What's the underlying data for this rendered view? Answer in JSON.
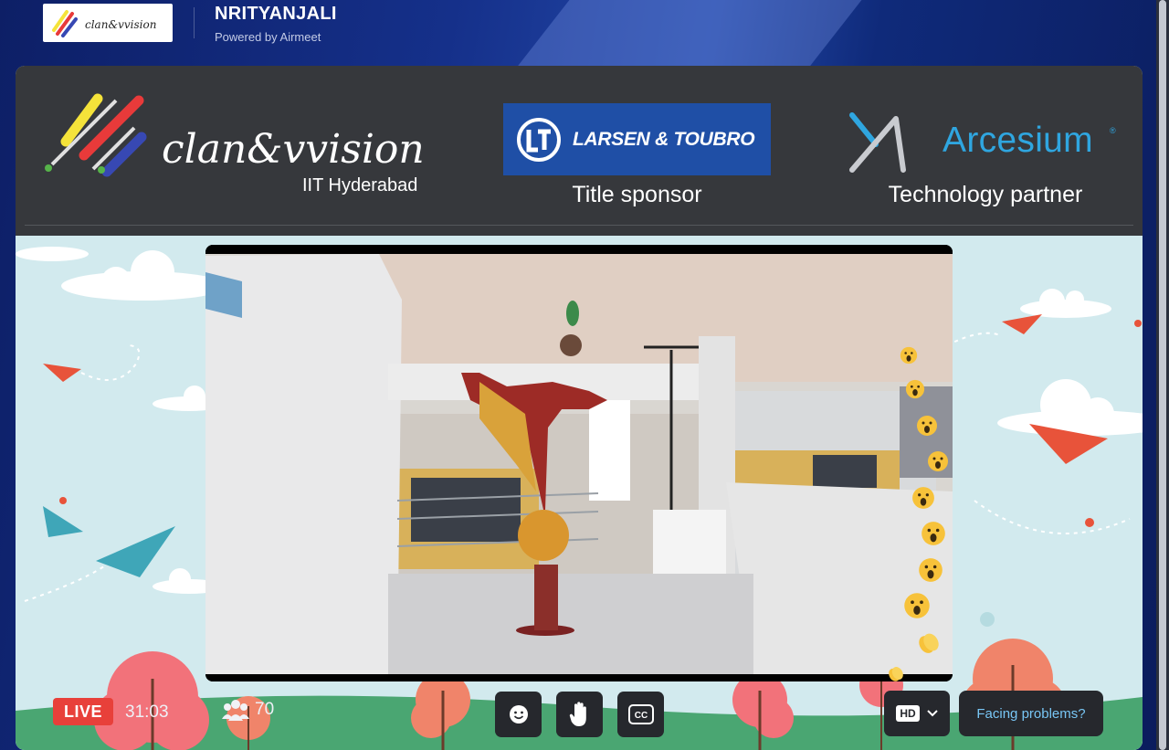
{
  "header": {
    "title": "NRITYANJALI",
    "powered_by": "Powered by Airmeet",
    "logo_text": "clan&vvision"
  },
  "banner": {
    "host_logo_text": "clan&vvision",
    "host_sub": "IIT Hyderabad",
    "sponsor_name": "LARSEN & TOUBRO",
    "sponsor_caption": "Title sponsor",
    "partner_name": "Arcesium",
    "partner_caption": "Technology partner"
  },
  "controls": {
    "live_label": "LIVE",
    "elapsed": "31:03",
    "viewer_count": "70",
    "emoji_icon": "smiley-icon",
    "raise_hand_icon": "hand-icon",
    "captions_label": "CC",
    "quality_label": "HD",
    "help_label": "Facing problems?"
  },
  "colors": {
    "live": "#e8403a",
    "help_text": "#78c6f5",
    "sponsor_blue": "#1f4fa6",
    "partner_blue": "#2fa6e0"
  }
}
